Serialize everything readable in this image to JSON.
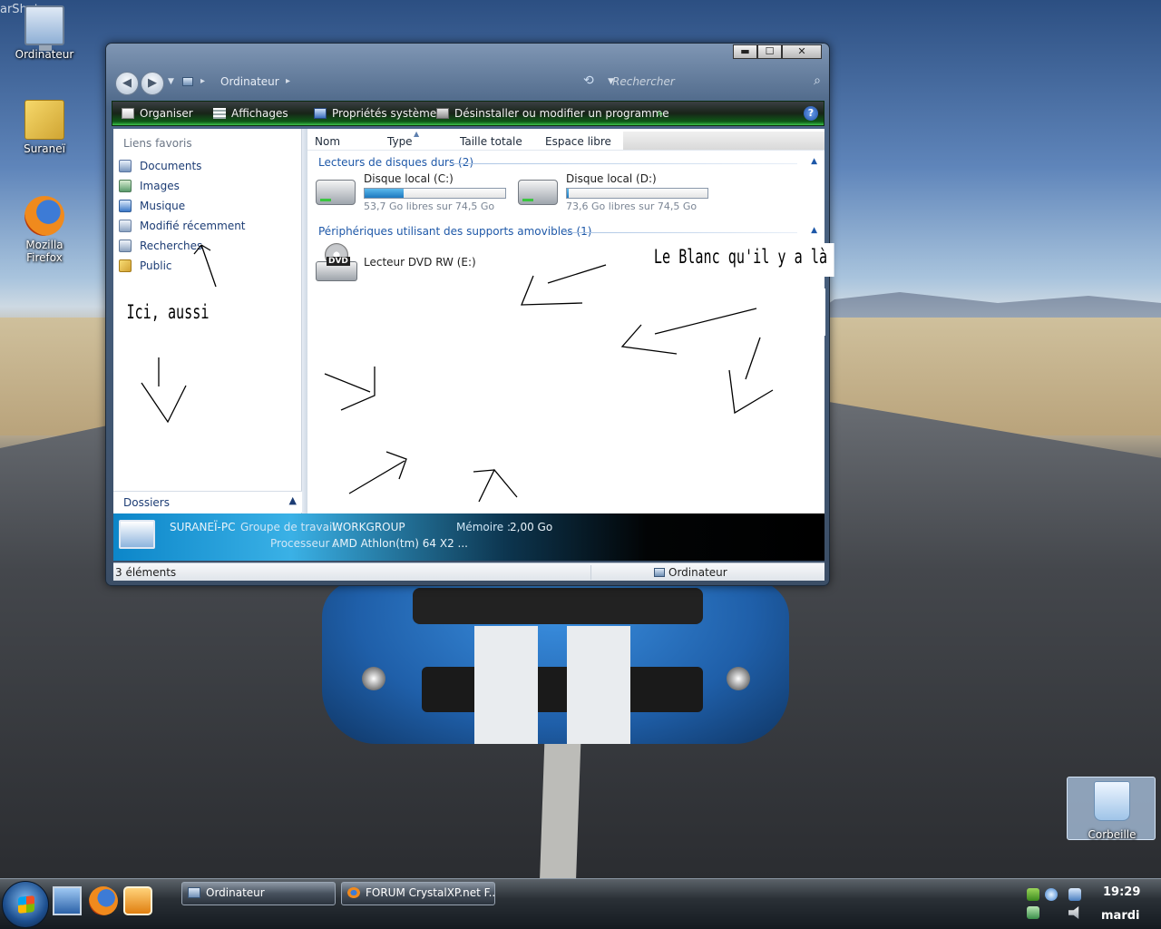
{
  "desktop": {
    "corner_text": "arShot",
    "icons": [
      {
        "label": "Ordinateur",
        "icon": "computer-icon"
      },
      {
        "label": "Suraneï",
        "icon": "user-folder-icon"
      },
      {
        "label": "Mozilla Firefox",
        "icon": "firefox-icon"
      },
      {
        "label": "Corbeille",
        "icon": "recycle-bin-icon"
      }
    ]
  },
  "window": {
    "controls": {
      "minimize": "▬",
      "maximize": "☐",
      "close": "✕"
    },
    "address": {
      "location": "Ordinateur",
      "separator": "▸"
    },
    "search_placeholder": "Rechercher",
    "toolbar": {
      "organize": "Organiser",
      "views": "Affichages",
      "system_properties": "Propriétés système",
      "uninstall": "Désinstaller ou modifier un programme",
      "more": "»",
      "help": "?"
    },
    "nav": {
      "heading": "Liens favoris",
      "links": [
        "Documents",
        "Images",
        "Musique",
        "Modifié récemment",
        "Recherches",
        "Public"
      ],
      "folders_label": "Dossiers"
    },
    "columns": [
      "Nom",
      "Type",
      "Taille totale",
      "Espace libre"
    ],
    "groups": {
      "hard_drives": "Lecteurs de disques durs (2)",
      "removable": "Périphériques utilisant des supports amovibles (1)"
    },
    "drives": [
      {
        "name": "Disque local (C:)",
        "free_text": "53,7 Go libres sur 74,5 Go",
        "used_fraction": 0.28
      },
      {
        "name": "Disque local (D:)",
        "free_text": "73,6 Go libres sur 74,5 Go",
        "used_fraction": 0.01
      }
    ],
    "dvd": {
      "name": "Lecteur DVD RW (E:)",
      "badge": "DVD"
    },
    "details": {
      "pc_name": "SURANEÏ-PC",
      "workgroup_label": "Groupe de travail :",
      "workgroup_value": "WORKGROUP",
      "memory_label": "Mémoire :",
      "memory_value": "2,00 Go",
      "processor_label": "Processeur :",
      "processor_value": "AMD Athlon(tm) 64 X2 ..."
    },
    "status": {
      "count": "3 éléments",
      "location": "Ordinateur"
    }
  },
  "annotations": {
    "note_right": "Le Blanc qu'il y a là",
    "note_left": "Ici, aussi"
  },
  "taskbar": {
    "buttons": [
      {
        "label": "Ordinateur"
      },
      {
        "label": "FORUM CrystalXP.net F..."
      }
    ],
    "clock": {
      "time": "19:29",
      "day": "mardi"
    }
  },
  "colors": {
    "toolbar_green": "#3cc34a",
    "link_blue": "#1c3c74",
    "group_blue": "#1e58a8",
    "details_cyan": "#3ab1e6"
  }
}
